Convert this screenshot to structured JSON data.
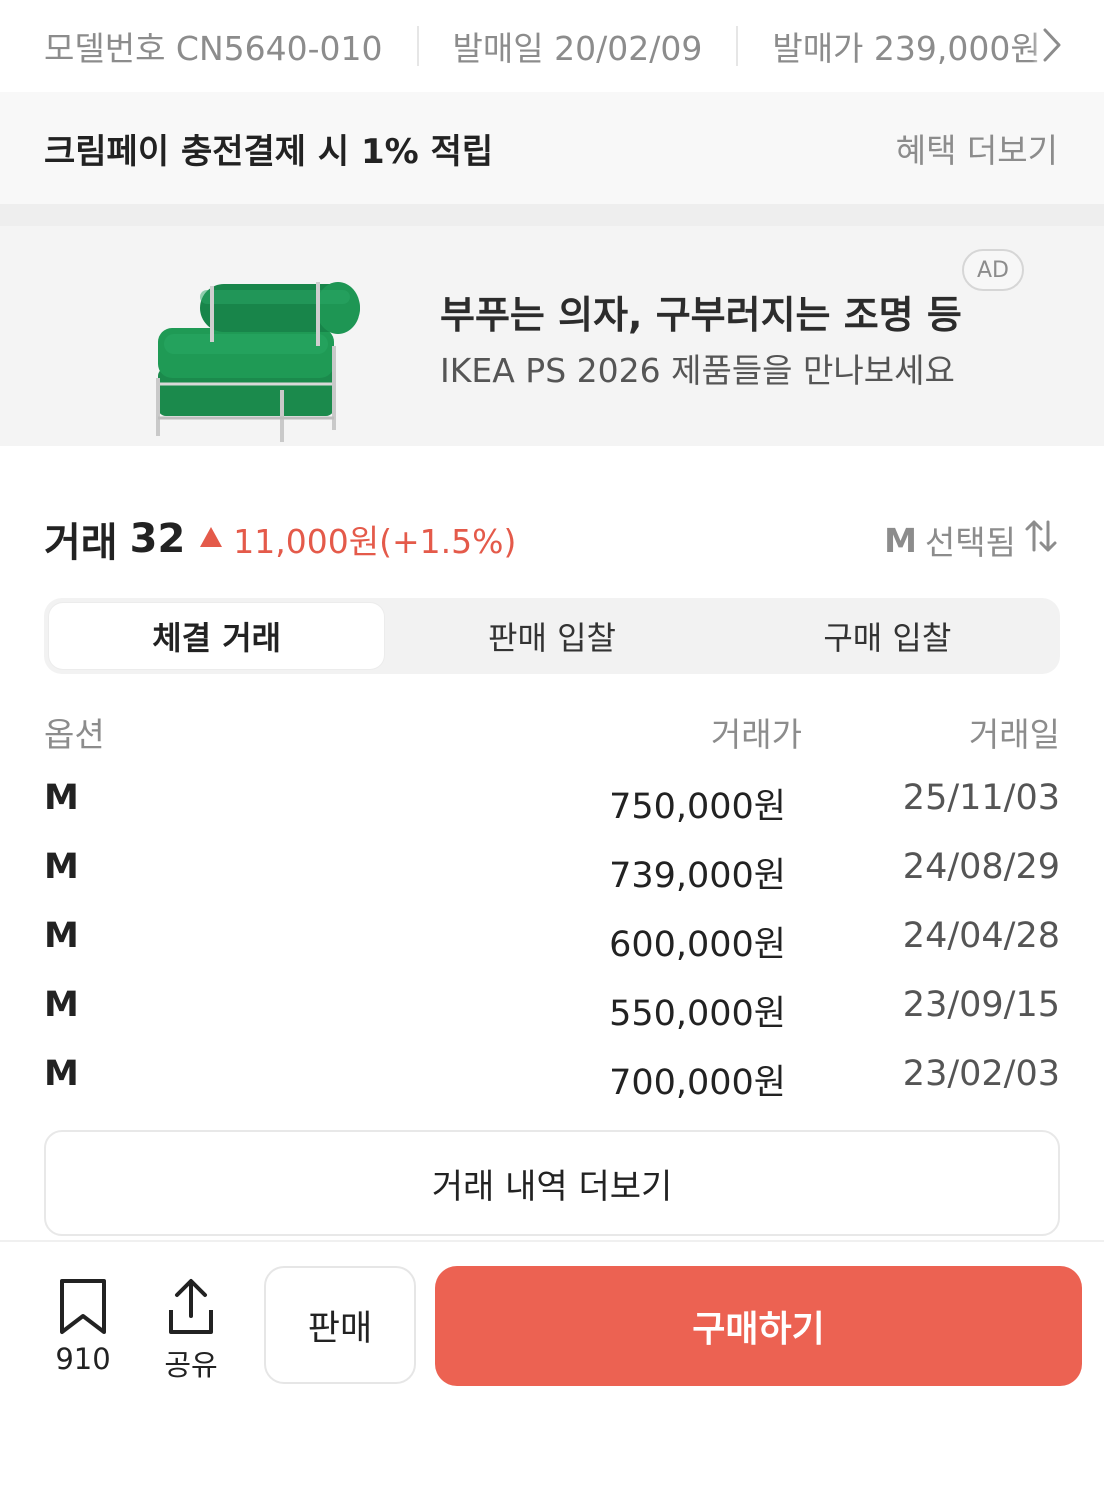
{
  "info_strip": {
    "model_number": "모델번호 CN5640-010",
    "release_date": "발매일 20/02/09",
    "release_price": "발매가 239,000원"
  },
  "benefit": {
    "text": "크림페이 충전결제 시 1% 적립",
    "more_label": "혜택 더보기"
  },
  "ad": {
    "badge": "AD",
    "title": "부푸는 의자, 구부러지는 조명 등",
    "subtitle": "IKEA PS 2026 제품들을 만나보세요"
  },
  "trade": {
    "label": "거래",
    "count": "32",
    "change": "11,000원(+1.5%)",
    "change_color": "#e45a4a",
    "size_value": "M",
    "size_suffix": "선택됨"
  },
  "tabs": [
    {
      "label": "체결 거래",
      "active": true
    },
    {
      "label": "판매 입찰",
      "active": false
    },
    {
      "label": "구매 입찰",
      "active": false
    }
  ],
  "table": {
    "headers": {
      "option": "옵션",
      "price": "거래가",
      "date": "거래일"
    },
    "rows": [
      {
        "option": "M",
        "price": "750,000원",
        "date": "25/11/03"
      },
      {
        "option": "M",
        "price": "739,000원",
        "date": "24/08/29"
      },
      {
        "option": "M",
        "price": "600,000원",
        "date": "24/04/28"
      },
      {
        "option": "M",
        "price": "550,000원",
        "date": "23/09/15"
      },
      {
        "option": "M",
        "price": "700,000원",
        "date": "23/02/03"
      }
    ],
    "more_label": "거래 내역 더보기"
  },
  "bottom_bar": {
    "bookmark_count": "910",
    "share_label": "공유",
    "sell_label": "판매",
    "buy_label": "구매하기",
    "buy_color": "#ec6252"
  }
}
